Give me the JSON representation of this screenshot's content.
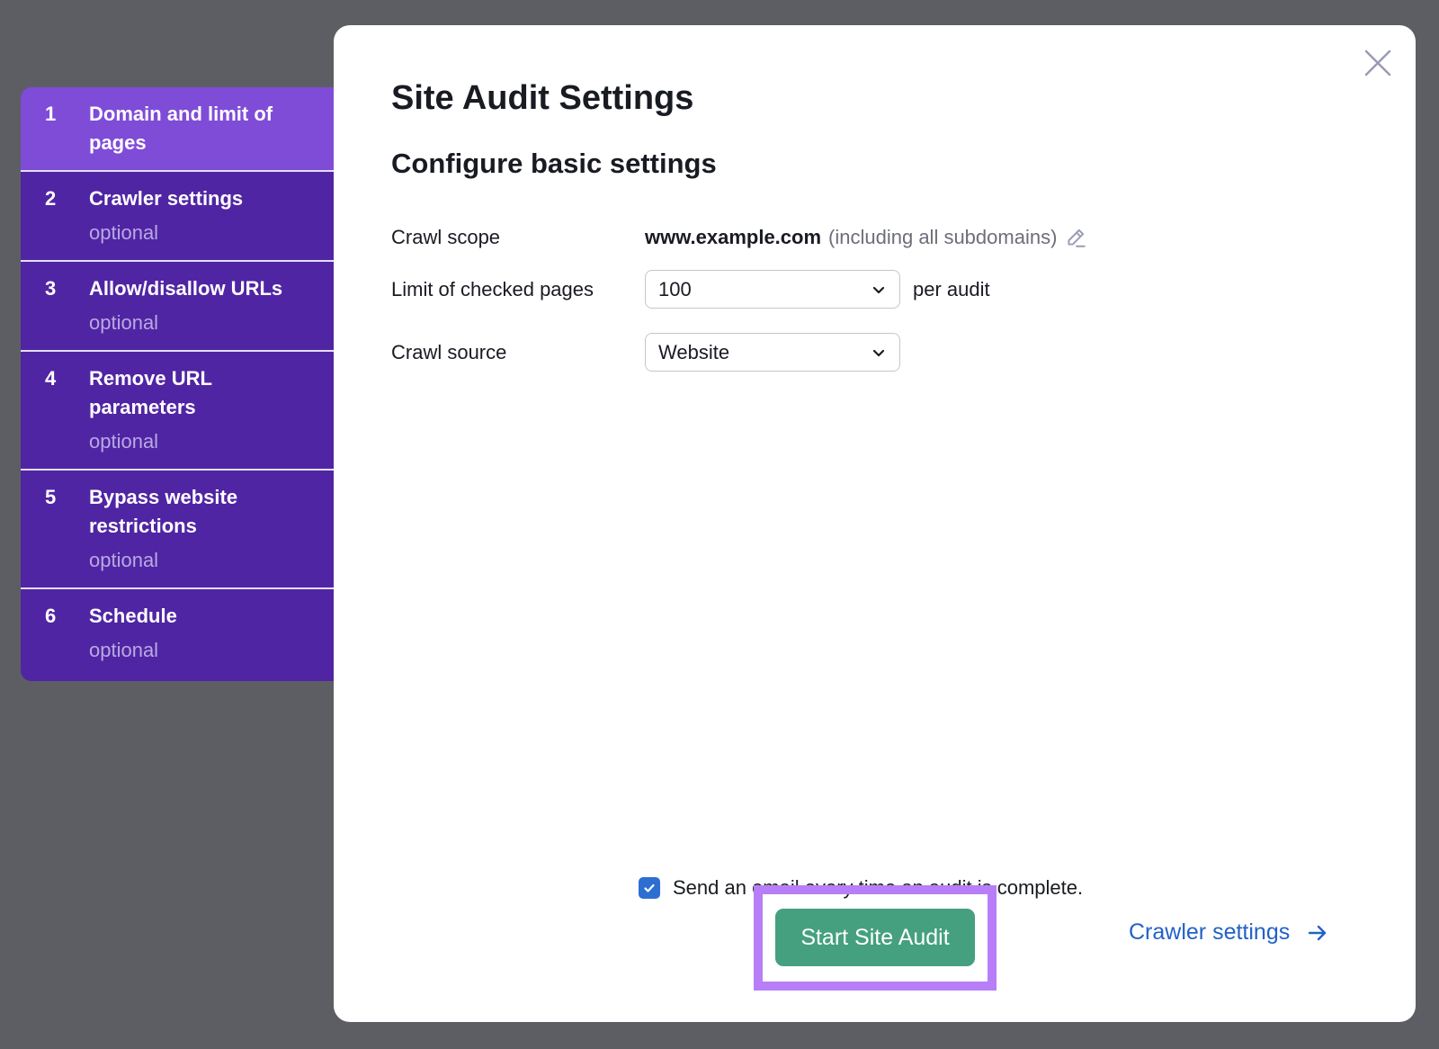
{
  "sidebar": {
    "steps": [
      {
        "number": "1",
        "label": "Domain and limit of pages",
        "sub": "",
        "active": true
      },
      {
        "number": "2",
        "label": "Crawler settings",
        "sub": "optional",
        "active": false
      },
      {
        "number": "3",
        "label": "Allow/disallow URLs",
        "sub": "optional",
        "active": false
      },
      {
        "number": "4",
        "label": "Remove URL parameters",
        "sub": "optional",
        "active": false
      },
      {
        "number": "5",
        "label": "Bypass website restrictions",
        "sub": "optional",
        "active": false
      },
      {
        "number": "6",
        "label": "Schedule",
        "sub": "optional",
        "active": false
      }
    ]
  },
  "modal": {
    "title": "Site Audit Settings",
    "subtitle": "Configure basic settings",
    "crawl_scope": {
      "label": "Crawl scope",
      "domain": "www.example.com",
      "note": "(including all subdomains)",
      "edit_icon": "pencil-icon"
    },
    "limit": {
      "label": "Limit of checked pages",
      "value": "100",
      "suffix": "per audit"
    },
    "source": {
      "label": "Crawl source",
      "value": "Website"
    },
    "email": {
      "checked": true,
      "label": "Send an email every time an audit is complete."
    },
    "start_button": "Start Site Audit",
    "next_link": "Crawler settings",
    "close_icon": "close-icon"
  },
  "colors": {
    "overlay": "#5d5e63",
    "step_active": "#7f4cd8",
    "step_inactive": "#5025a3",
    "primary_button": "#45a07f",
    "link": "#2262c6",
    "highlight": "#b87ef8",
    "checkbox": "#2c6fd1"
  }
}
